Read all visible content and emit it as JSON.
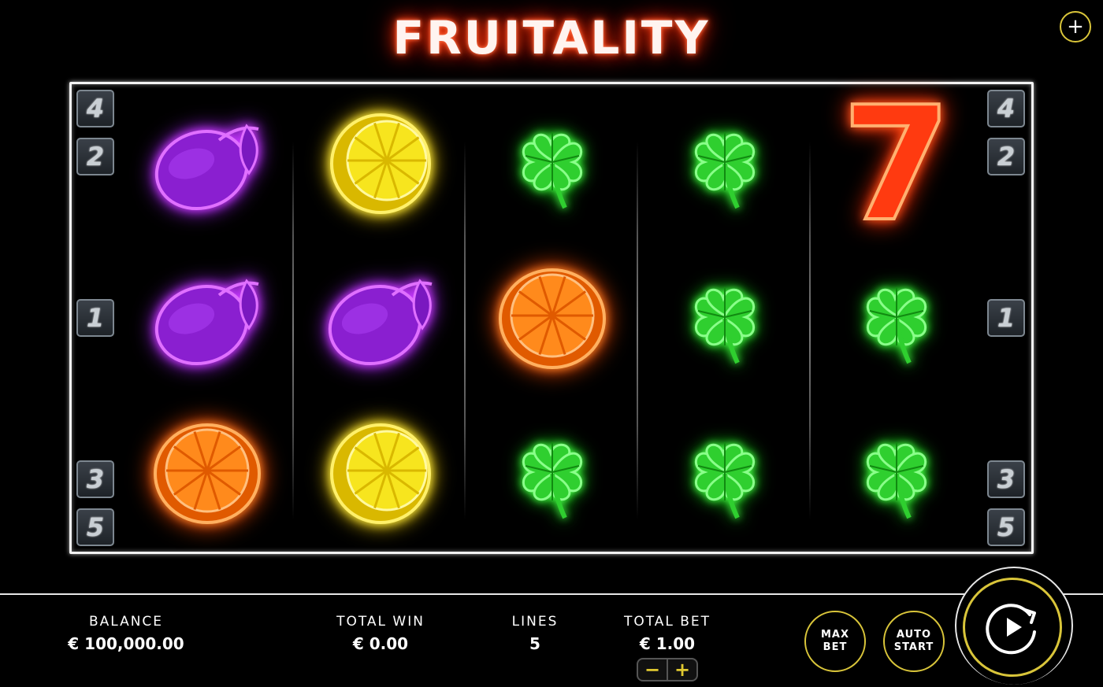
{
  "game": {
    "title": "FRUITALITY"
  },
  "menu": {
    "icon": "+"
  },
  "paylines": {
    "left": [
      "4",
      "2",
      "1",
      "3",
      "5"
    ],
    "right": [
      "4",
      "2",
      "1",
      "3",
      "5"
    ]
  },
  "reels": [
    [
      "plum",
      "plum",
      "orange"
    ],
    [
      "lemon",
      "plum",
      "lemon"
    ],
    [
      "clover",
      "orange",
      "clover"
    ],
    [
      "clover",
      "clover",
      "clover"
    ],
    [
      "seven",
      "clover",
      "clover"
    ]
  ],
  "seven_label": "7",
  "stats": {
    "balance": {
      "label": "BALANCE",
      "value": "€ 100,000.00"
    },
    "total_win": {
      "label": "TOTAL WIN",
      "value": "€ 0.00"
    },
    "lines": {
      "label": "LINES",
      "value": "5"
    },
    "total_bet": {
      "label": "TOTAL BET",
      "value": "€ 1.00"
    }
  },
  "bet_stepper": {
    "minus": "−",
    "plus": "+"
  },
  "buttons": {
    "max_bet": [
      "MAX",
      "BET"
    ],
    "auto_start": [
      "AUTO",
      "START"
    ]
  },
  "colors": {
    "accent": "#d9c53a",
    "plum": "#8a1fd0",
    "lemon": "#f7e51e",
    "orange": "#ff8a1c",
    "clover": "#2fcf2f",
    "seven": "#ff3a10"
  }
}
